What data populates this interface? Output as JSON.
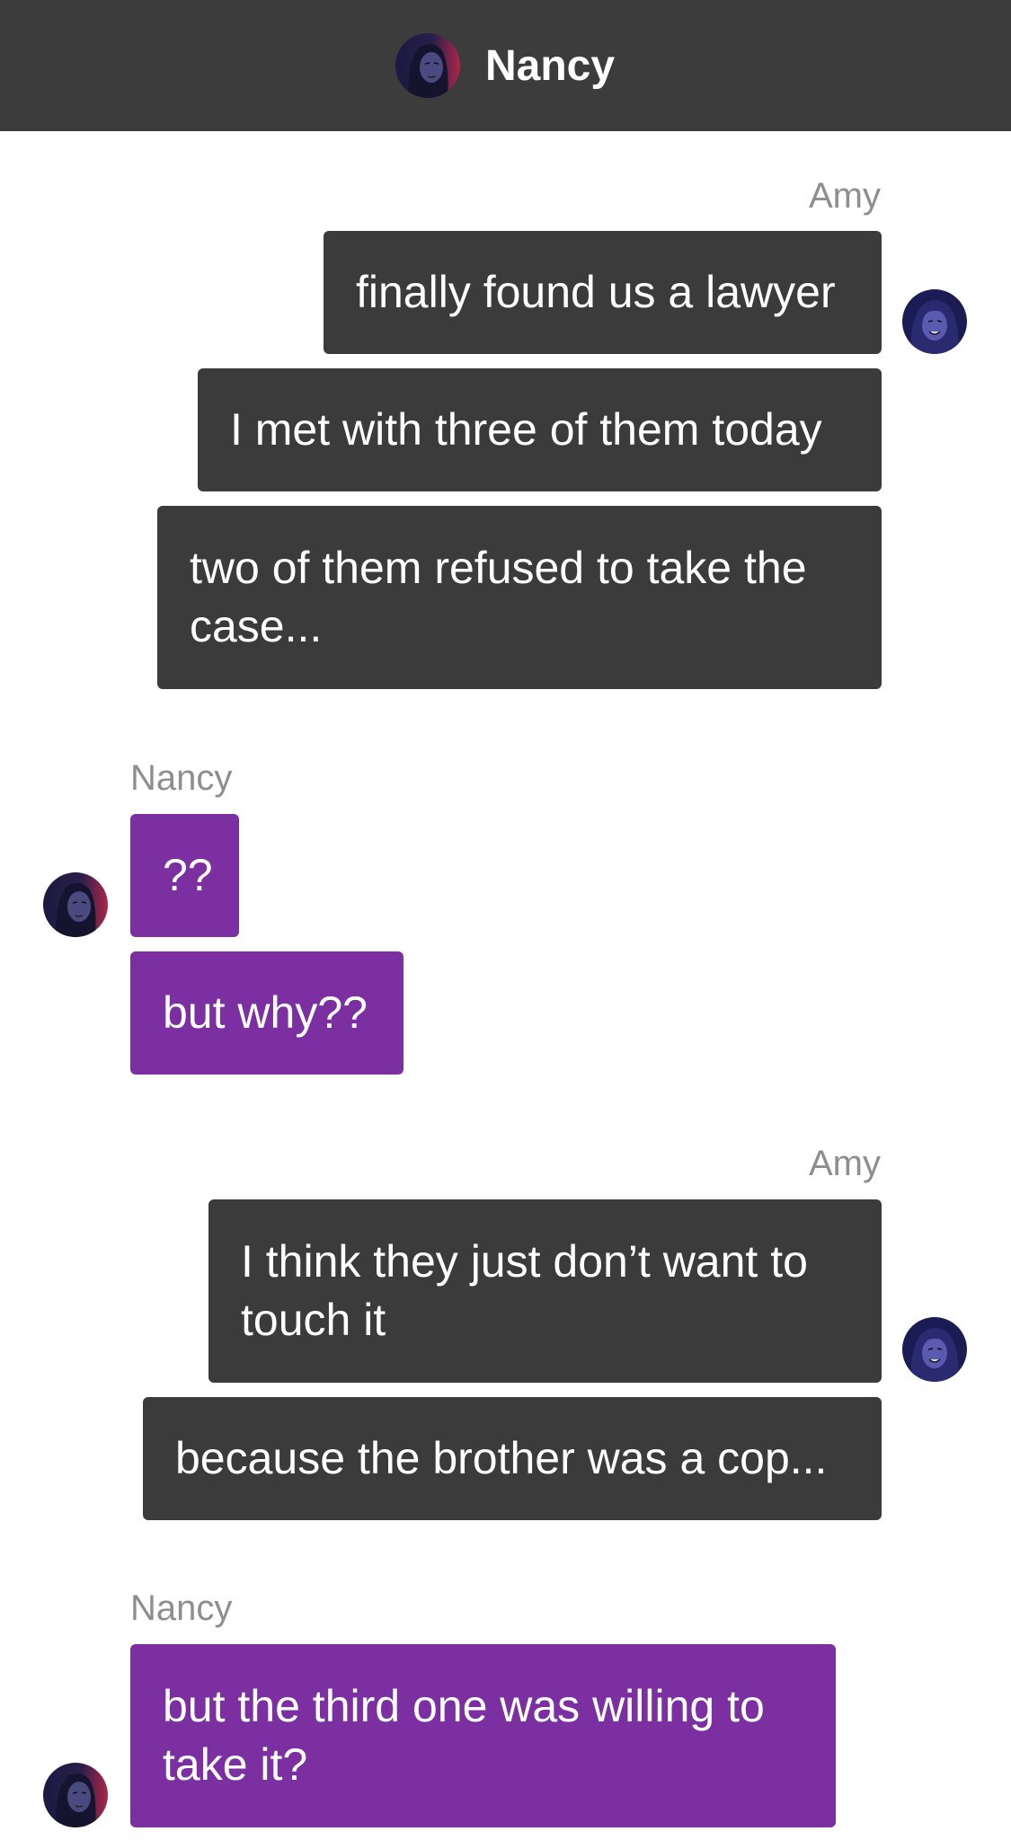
{
  "header": {
    "title": "Nancy",
    "avatar_icon": "nancy-avatar-icon"
  },
  "colors": {
    "header_bg": "#3c3c3c",
    "outgoing_bubble": "#3b3b3b",
    "incoming_bubble": "#7b2fa0",
    "sender_label": "#8e8e8e"
  },
  "messages": {
    "group1": {
      "sender": "Amy",
      "m1": "finally found us a lawyer",
      "m2": "I met with three of them today",
      "m3": "two of them refused to take the case..."
    },
    "group2": {
      "sender": "Nancy",
      "m1": "??",
      "m2": "but why??"
    },
    "group3": {
      "sender": "Amy",
      "m1": "I think they just don’t want to touch it",
      "m2": "because the brother was a cop..."
    },
    "group4": {
      "sender": "Nancy",
      "m1": "but the third one was willing to take it?"
    }
  }
}
